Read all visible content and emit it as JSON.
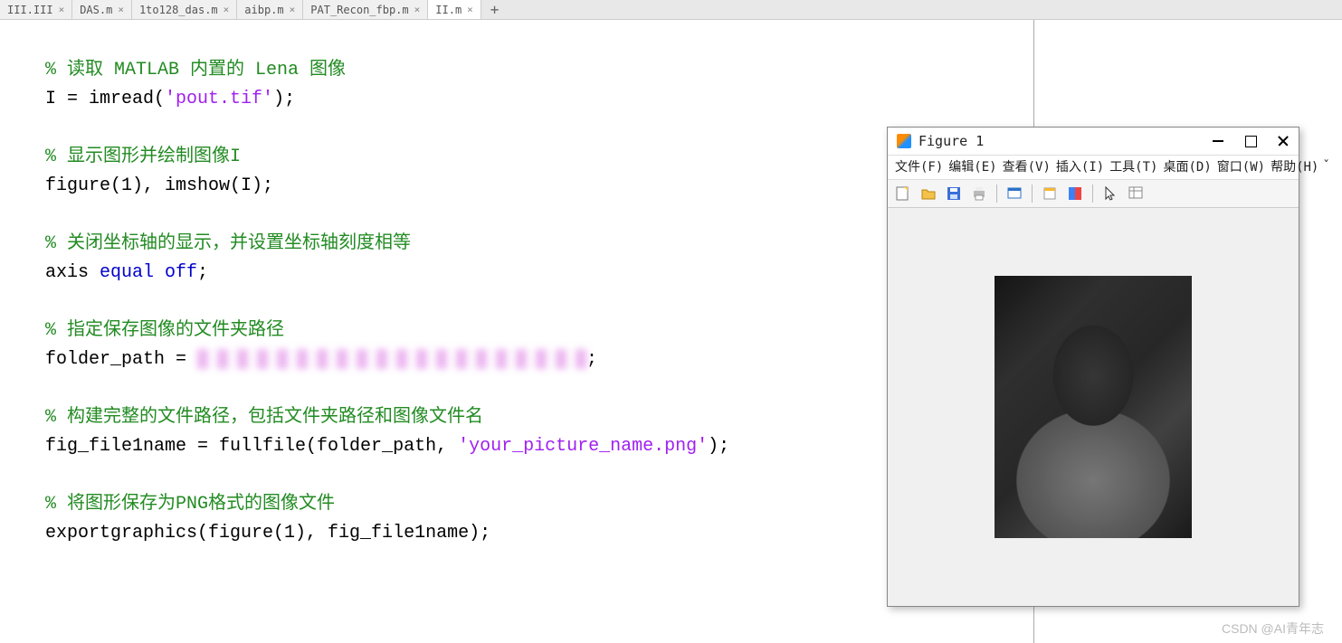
{
  "tabs": [
    {
      "label": "III.III"
    },
    {
      "label": "DAS.m"
    },
    {
      "label": "1to128_das.m"
    },
    {
      "label": "aibp.m"
    },
    {
      "label": "PAT_Recon_fbp.m"
    },
    {
      "label": "II.m"
    }
  ],
  "code": {
    "c1": "% 读取 MATLAB 内置的 Lena 图像",
    "l1a": "I = imread(",
    "l1s": "'pout.tif'",
    "l1b": ");",
    "c2": "% 显示图形并绘制图像I",
    "l2": "figure(1), imshow(I);",
    "c3": "% 关闭坐标轴的显示，并设置坐标轴刻度相等",
    "l3a": "axis ",
    "l3k": "equal off",
    "l3b": ";",
    "c4": "% 指定保存图像的文件夹路径",
    "l4": "folder_path = ",
    "c5": "% 构建完整的文件路径，包括文件夹路径和图像文件名",
    "l5a": "fig_file1name = fullfile(folder_path, ",
    "l5s": "'your_picture_name.png'",
    "l5b": ");",
    "c6": "% 将图形保存为PNG格式的图像文件",
    "l6": "exportgraphics(figure(1), fig_file1name);"
  },
  "figure": {
    "title": "Figure 1",
    "menus": [
      "文件(F)",
      "编辑(E)",
      "查看(V)",
      "插入(I)",
      "工具(T)",
      "桌面(D)",
      "窗口(W)",
      "帮助(H)"
    ],
    "image_name": "pout.tif"
  },
  "watermark": "CSDN @AI青年志"
}
